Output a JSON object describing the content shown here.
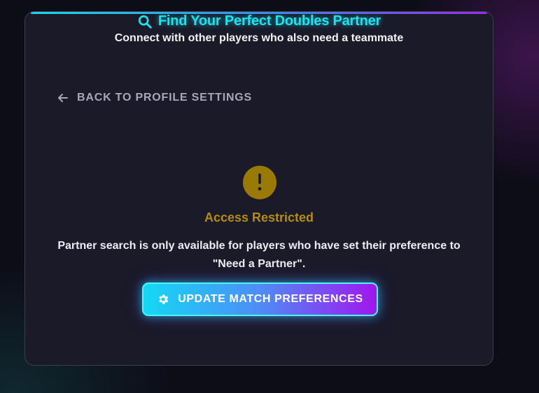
{
  "header": {
    "title": "Find Your Perfect Doubles Partner",
    "subtitle": "Connect with other players who also need a teammate",
    "title_icon": "search-icon",
    "accent_color": "#18e4f2"
  },
  "navigation": {
    "back_label": "BACK TO PROFILE SETTINGS",
    "back_icon": "arrow-left-icon"
  },
  "notice": {
    "icon": "exclamation-icon",
    "heading": "Access Restricted",
    "message": "Partner search is only available for players who have set their preference to \"Need a Partner\".",
    "warning_color": "#9a7a06"
  },
  "action": {
    "button_label": "UPDATE MATCH PREFERENCES",
    "button_icon": "gear-icon",
    "gradient_start": "#14d8f4",
    "gradient_end": "#a116ee"
  }
}
